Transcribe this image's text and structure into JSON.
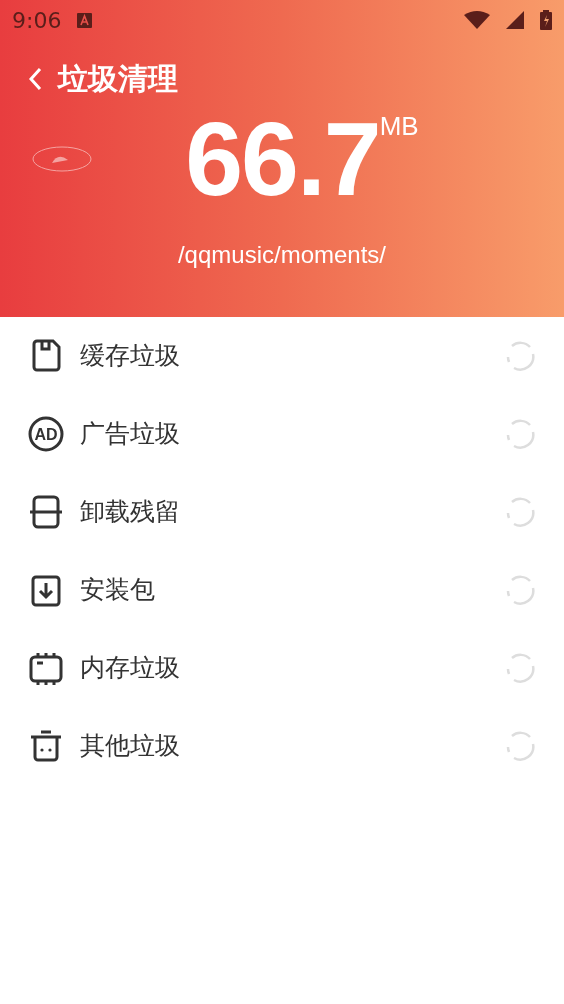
{
  "status_bar": {
    "time": "9:06"
  },
  "header": {
    "title": "垃圾清理",
    "size": "66.7",
    "unit": "MB",
    "path": "/qqmusic/moments/"
  },
  "items": [
    {
      "label": "缓存垃圾",
      "kind": "cache"
    },
    {
      "label": "广告垃圾",
      "kind": "ad",
      "icon_text": "AD"
    },
    {
      "label": "卸载残留",
      "kind": "residue"
    },
    {
      "label": "安装包",
      "kind": "package"
    },
    {
      "label": "内存垃圾",
      "kind": "memory"
    },
    {
      "label": "其他垃圾",
      "kind": "other"
    }
  ]
}
